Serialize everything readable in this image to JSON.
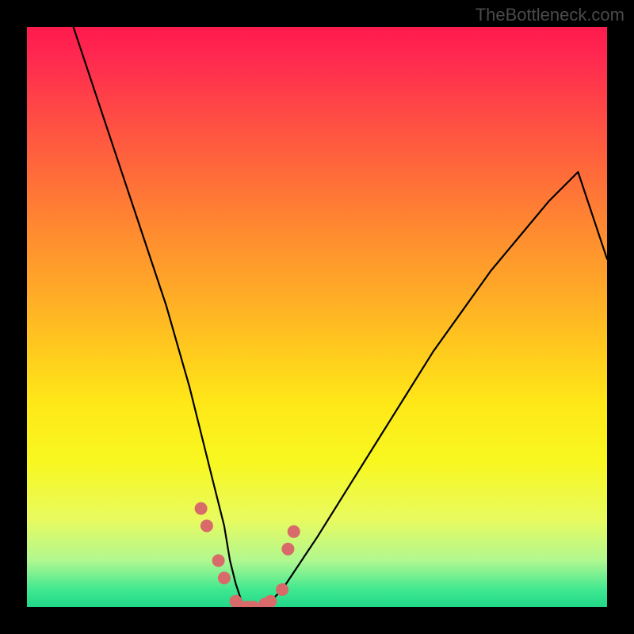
{
  "watermark": "TheBottleneck.com",
  "chart_data": {
    "type": "line",
    "title": "",
    "xlabel": "",
    "ylabel": "",
    "xlim": [
      0,
      100
    ],
    "ylim": [
      0,
      100
    ],
    "grid": false,
    "legend": false,
    "annotations": [],
    "series": [
      {
        "name": "bottleneck-curve",
        "color": "#000000",
        "x": [
          8,
          12,
          16,
          20,
          24,
          28,
          30,
          32,
          34,
          35,
          36,
          37,
          38,
          40,
          42,
          44,
          46,
          50,
          55,
          60,
          65,
          70,
          75,
          80,
          85,
          90,
          95,
          100
        ],
        "y": [
          100,
          88,
          76,
          64,
          52,
          38,
          30,
          22,
          14,
          8,
          4,
          1,
          0,
          0,
          1,
          3,
          6,
          12,
          20,
          28,
          36,
          44,
          51,
          58,
          64,
          70,
          75,
          60
        ]
      }
    ],
    "markers": {
      "name": "highlight-dots",
      "color": "#d96a6a",
      "points": [
        {
          "x": 30,
          "y": 17
        },
        {
          "x": 31,
          "y": 14
        },
        {
          "x": 33,
          "y": 8
        },
        {
          "x": 34,
          "y": 5
        },
        {
          "x": 36,
          "y": 1
        },
        {
          "x": 37,
          "y": 0
        },
        {
          "x": 38,
          "y": 0
        },
        {
          "x": 39,
          "y": 0
        },
        {
          "x": 41,
          "y": 0.5
        },
        {
          "x": 42,
          "y": 1
        },
        {
          "x": 44,
          "y": 3
        },
        {
          "x": 45,
          "y": 10
        },
        {
          "x": 46,
          "y": 13
        }
      ]
    },
    "gradient_stops": [
      {
        "pos": 0,
        "color": "#ff1a4d"
      },
      {
        "pos": 25,
        "color": "#ff6a3a"
      },
      {
        "pos": 50,
        "color": "#ffb820"
      },
      {
        "pos": 75,
        "color": "#f8f820"
      },
      {
        "pos": 100,
        "color": "#20d888"
      }
    ]
  }
}
